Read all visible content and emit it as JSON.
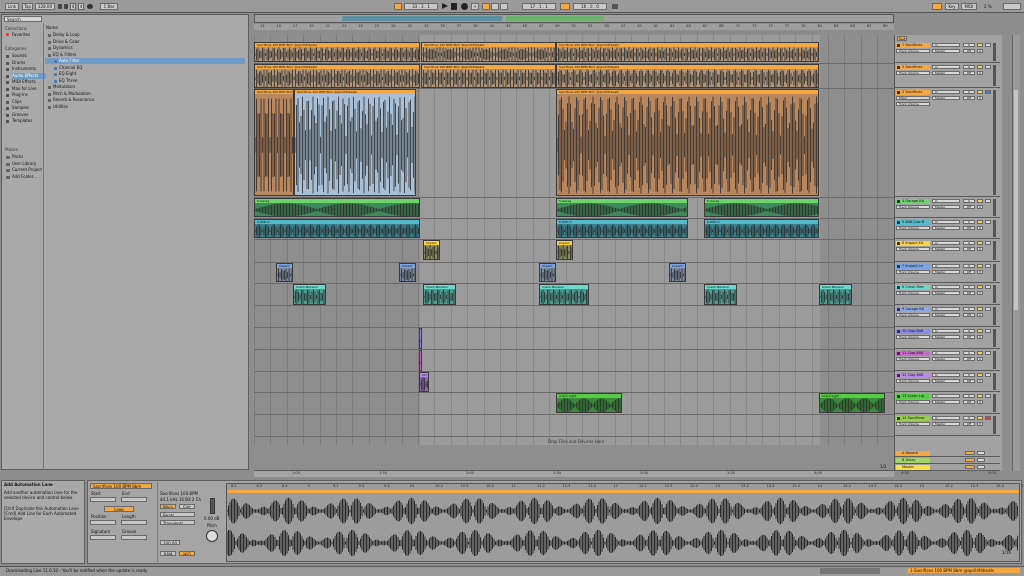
{
  "transport": {
    "link": "Link",
    "tap": "Tap",
    "tempo": "128.00",
    "sig_num": "4",
    "sig_den": "4",
    "quant": "1 Bar",
    "position": "33 . 3 . 1",
    "loop_start": "17 . 1 . 1",
    "loop_len": "16 . 0 . 0",
    "key": "Key",
    "midi": "MIDI",
    "cpu": "2 %"
  },
  "browser": {
    "search_placeholder": "Search",
    "collections_header": "Collections",
    "favorites": "Favorites",
    "categories_header": "Categories",
    "categories": [
      "Sounds",
      "Drums",
      "Instruments",
      "Audio Effects",
      "MIDI Effects",
      "Max for Live",
      "Plug-Ins",
      "Clips",
      "Samples",
      "Grooves",
      "Templates"
    ],
    "places_header": "Places",
    "places": [
      "Packs",
      "User Library",
      "Current Project",
      "Add Folder..."
    ],
    "name_header": "Name",
    "items": [
      "Delay & Loop",
      "Drive & Color",
      "Dynamics",
      "EQ & Filters",
      "Auto Filter",
      "Channel EQ",
      "EQ Eight",
      "EQ Three",
      "Modulators",
      "Pitch & Modulation",
      "Reverb & Resonance",
      "Utilities"
    ]
  },
  "arrangement": {
    "bar_numbers": [
      "13",
      "15",
      "17",
      "19",
      "21",
      "23",
      "25",
      "27",
      "29",
      "31",
      "33",
      "35",
      "37",
      "39",
      "41",
      "43",
      "45",
      "47",
      "49",
      "51",
      "53",
      "55",
      "57",
      "59",
      "61",
      "63",
      "65",
      "67",
      "69",
      "71",
      "73",
      "75",
      "77",
      "79",
      "81",
      "83",
      "85",
      "87",
      "89",
      "91"
    ],
    "times": [
      "1:00",
      "1:30",
      "2:00",
      "2:30",
      "3:00",
      "3:30",
      "4:00",
      "4:30",
      "5:00"
    ],
    "drop_hint": "Drop Files and Devices Here",
    "page_indicator": "1/2"
  },
  "clips": {
    "sacrifices": "Sacrifices 100 BPM 8bm @april4thbeats",
    "garage": "5-Garag",
    "gate808": "6-808 Cl",
    "impact": "Impact",
    "crash": "Crash Mansion",
    "crash_light": "Crash Light",
    "chr": "Chr"
  },
  "tracks": [
    {
      "name": "1 Sacrifices",
      "input": "Track Volume",
      "color": "#f5a742"
    },
    {
      "name": "2 Sacrifices",
      "input": "Track Volume",
      "color": "#f5a742"
    },
    {
      "name": "3 Sacrifices",
      "input": "Mixer",
      "sub": "Track Volume",
      "color": "#f5a742"
    },
    {
      "name": "4 Garage Kit",
      "input": "Track Volume",
      "color": "#6cd46a"
    },
    {
      "name": "5 808 Cow B",
      "input": "Track Volume",
      "color": "#54b9c8"
    },
    {
      "name": "6 Impact Kit",
      "input": "Track Volume",
      "color": "#f5d24a"
    },
    {
      "name": "7 Impact La",
      "input": "Track Volume",
      "color": "#7aa3e0"
    },
    {
      "name": "8 Crash Man",
      "input": "Track Volume",
      "color": "#6ad8cc"
    },
    {
      "name": "9 Garage Kit",
      "input": "Track Volume",
      "color": "#8ca6e6"
    },
    {
      "name": "10 Clap 808",
      "input": "Track Volume",
      "color": "#8a8ae8"
    },
    {
      "name": "11 Clap 808",
      "input": "Track Volume",
      "color": "#cc66cc"
    },
    {
      "name": "12 Clap 808",
      "input": "Track Volume",
      "color": "#b68ae8"
    },
    {
      "name": "13 Crash Lig",
      "input": "Track Volume",
      "color": "#55cc44"
    },
    {
      "name": "14 Sacrifices",
      "input": "Track Volume",
      "color": "#99cc55"
    }
  ],
  "returns": [
    {
      "name": "A Reverb",
      "color": "#f5a742"
    },
    {
      "name": "B Delay",
      "color": "#a6d46a"
    },
    {
      "name": "Master",
      "color": "#f5e04a"
    }
  ],
  "mixer": {
    "in": "In",
    "auto": "Auto",
    "off": "Off",
    "master": "Master",
    "s": "S",
    "val": "0"
  },
  "info": {
    "title": "Add Automation Lane",
    "body": "Add another automation lane for the selected device and control below.",
    "shortcut": "[Ctrl] Duplicate this Automation Lane [Cmd] Add Line for Each Automated Envelope"
  },
  "clip_view": {
    "name": "Sacrifices 100 BPM 8bm",
    "start": "Start",
    "end": "End",
    "loop": "Loop",
    "position": "Position",
    "length": "Length",
    "signature": "Signature",
    "groove": "Groove",
    "sample": "Sacrifices 100 BPM",
    "sample_info": "44.1 kHz 16 Bit 2 Ch",
    "warp": "Warp",
    "edit": "Edit",
    "beats": "Beats",
    "transients": "Transients",
    "bpm": "100.00",
    "gain": "0.00 dB",
    "pitch": "Pitch",
    "ram": "RAM",
    "hiq": "HiQ",
    "zoom": "1/16",
    "ruler": [
      "8.2",
      "8.3",
      "8.4",
      "9",
      "9.2",
      "9.3",
      "9.4",
      "10",
      "10.2",
      "10.3",
      "10.4",
      "11",
      "11.2",
      "11.3",
      "11.4",
      "12",
      "12.2",
      "12.3",
      "12.4",
      "13",
      "13.2",
      "13.3",
      "13.4",
      "14",
      "14.2",
      "14.3",
      "14.4",
      "15",
      "15.2",
      "15.3",
      "15.4",
      "16"
    ]
  },
  "status": {
    "message": "Downloading Live 11.0.10 - You'll be notified when the update is ready",
    "right": "1-Sacrifices 100 BPM 8bm @april4thbeats"
  }
}
